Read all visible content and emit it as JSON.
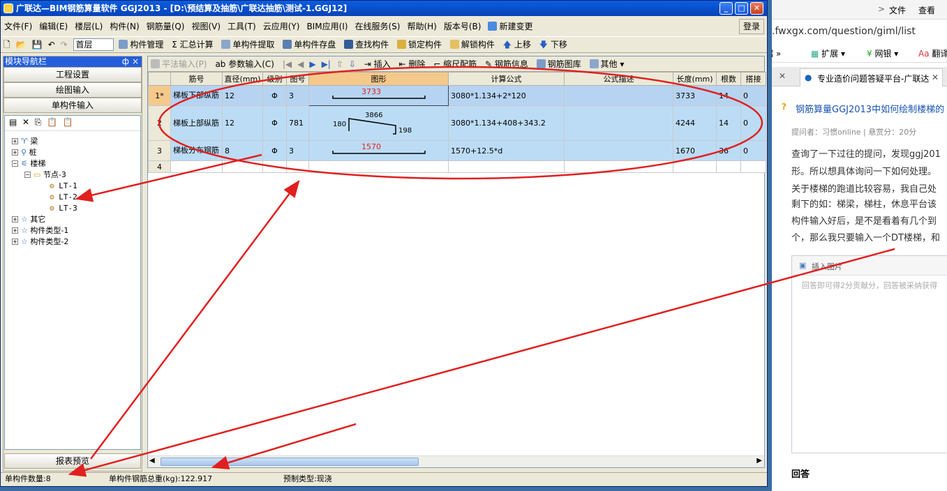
{
  "window": {
    "title": "广联达—BIM钢筋算量软件 GGJ2013 - [D:\\预结算及抽筋\\广联达抽筋\\测试-1.GGJ12]"
  },
  "menu": [
    "文件(F)",
    "编辑(E)",
    "楼层(L)",
    "构件(N)",
    "钢筋量(Q)",
    "视图(V)",
    "工具(T)",
    "云应用(Y)",
    "BIM应用(I)",
    "在线服务(S)",
    "帮助(H)",
    "版本号(B)"
  ],
  "menu_extra": {
    "new_change": "新建变更",
    "login": "登录"
  },
  "toolbar": {
    "floor": "首层",
    "items": [
      "构件管理",
      "汇总计算",
      "单构件提取",
      "单构件存盘",
      "查找构件",
      "锁定构件",
      "解锁构件",
      "上移",
      "下移"
    ]
  },
  "left": {
    "title": "模块导航栏",
    "pin": "ф",
    "buttons": [
      "工程设置",
      "绘图输入",
      "单构件输入"
    ],
    "tree": {
      "beam": "梁",
      "pile": "桩",
      "stair": "楼梯",
      "node": "节点-3",
      "lt1": "LT-1",
      "lt2": "LT-2",
      "lt3": "LT-3",
      "other": "其它",
      "type1": "构件类型-1",
      "type2": "构件类型-2"
    },
    "report": "报表预览"
  },
  "grid_toolbar": [
    "平法输入(P)",
    "参数输入(C)",
    "插入",
    "删除",
    "缩尺配筋",
    "钢筋信息",
    "钢筋图库",
    "其他"
  ],
  "table": {
    "headers": [
      "",
      "筋号",
      "直径(mm)",
      "级别",
      "图号",
      "图形",
      "计算公式",
      "公式描述",
      "长度(mm)",
      "根数",
      "搭接"
    ],
    "rows": [
      {
        "no": "1*",
        "name": "梯板下部纵筋",
        "dia": "12",
        "grade": "Φ",
        "fig": "3",
        "shape": "3733",
        "formula": "3080*1.134+2*120",
        "desc": "",
        "len": "3733",
        "count": "14",
        "lap": "0"
      },
      {
        "no": "2",
        "name": "梯板上部纵筋",
        "dia": "12",
        "grade": "Φ",
        "fig": "781",
        "shape_left": "180",
        "shape_top": "3866",
        "shape_right": "198",
        "formula": "3080*1.134+408+343.2",
        "desc": "",
        "len": "4244",
        "count": "14",
        "lap": "0"
      },
      {
        "no": "3",
        "name": "梯板分布钢筋",
        "dia": "8",
        "grade": "Φ",
        "fig": "3",
        "shape": "1570",
        "formula": "1570+12.5*d",
        "desc": "",
        "len": "1670",
        "count": "36",
        "lap": "0"
      },
      {
        "no": "4",
        "name": "",
        "dia": "",
        "grade": "",
        "fig": "",
        "shape": "",
        "formula": "",
        "desc": "",
        "len": "",
        "count": "",
        "lap": ""
      }
    ]
  },
  "status": {
    "count": "单构件数量:8",
    "weight": "单构件钢筋总重(kg):122.917",
    "type": "预制类型:现浇"
  },
  "browser": {
    "nav1": "文件",
    "nav2": "查看",
    "url": ".fwxgx.com/question/giml/list",
    "toolbar": [
      "招 »",
      "扩展",
      "网银",
      "翻译"
    ],
    "tab": "专业造价问题答疑平台-广联达",
    "question": "钢筋算量GGJ2013中如何绘制楼梯的",
    "meta": "提问者：习惯online  |  悬赏分：20分",
    "body": [
      "查询了一下过往的提问，发现ggj201",
      "形。所以想具体询问一下如何处理。",
      "关于楼梯的跑道比较容易，我自己处",
      "剩下的如：梯梁，梯柱，休息平台该",
      "构件输入好后，是不是看着有几个到",
      "个，那么我只要输入一个DT楼梯，和"
    ],
    "insert": "插入图片",
    "hint": "回答即可得2分贡献分，回答被采纳获得",
    "answer": "回答"
  },
  "colors": {
    "annotation": "#e02020",
    "title": "#0a5ee0",
    "selection": "#bcdcf6"
  }
}
